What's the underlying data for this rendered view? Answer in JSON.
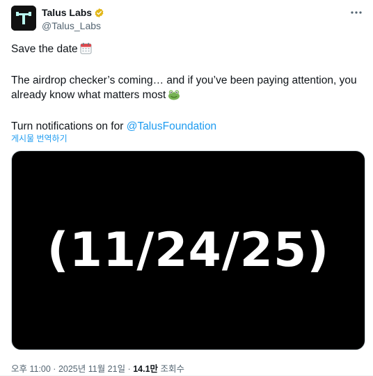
{
  "author": {
    "display_name": "Talus Labs",
    "handle": "@Talus_Labs",
    "verified_color": "#E2B719"
  },
  "tweet": {
    "line1": "Save the date",
    "line1_emoji": "calendar-icon",
    "line2": "The airdrop checker’s coming… and if you’ve been paying attention, you already know what matters most",
    "line2_emoji": "frog-icon",
    "line3_prefix": "Turn notifications on for ",
    "line3_mention": "@TalusFoundation"
  },
  "translate_label": "게시물 번역하기",
  "media": {
    "text": "(11/24/25)"
  },
  "meta": {
    "time": "오후 11:00",
    "separator1": " · ",
    "date": "2025년 11월 21일",
    "separator2": " · ",
    "views": "14.1만",
    "views_label": " 조회수"
  },
  "colors": {
    "accent": "#1d9bf0",
    "secondary_text": "#536471",
    "primary_text": "#0f1419",
    "media_bg": "#000000",
    "logo_color": "#b9f6ef"
  }
}
